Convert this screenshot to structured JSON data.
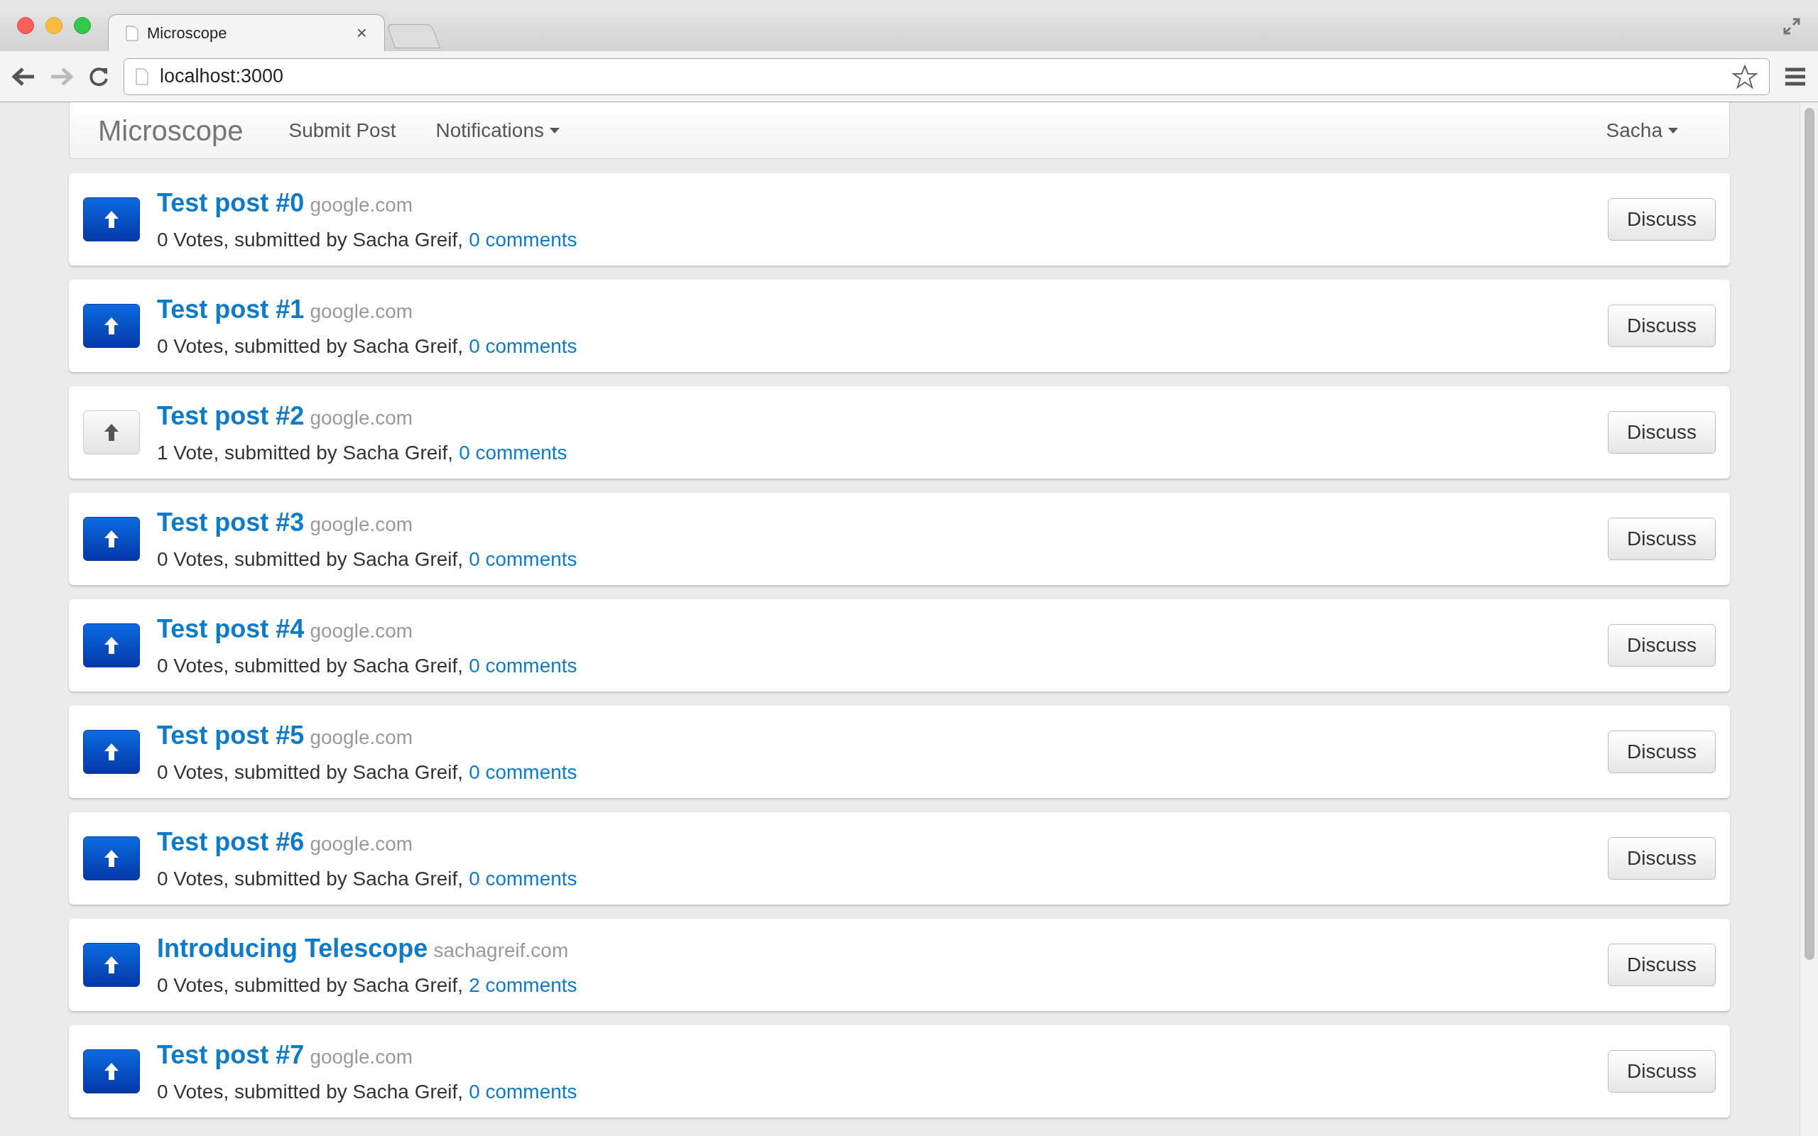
{
  "browser": {
    "tab_title": "Microscope",
    "tab_close": "×",
    "address": "localhost:3000"
  },
  "navbar": {
    "brand": "Microscope",
    "links": [
      {
        "label": "Submit Post",
        "kind": "link"
      },
      {
        "label": "Notifications",
        "kind": "dropdown"
      }
    ],
    "user": "Sacha"
  },
  "posts": [
    {
      "title": "Test post #0",
      "domain": "google.com",
      "meta": "0 Votes, submitted by Sacha Greif,",
      "comments": "0 comments",
      "upvoted": false,
      "action": "Discuss"
    },
    {
      "title": "Test post #1",
      "domain": "google.com",
      "meta": "0 Votes, submitted by Sacha Greif,",
      "comments": "0 comments",
      "upvoted": false,
      "action": "Discuss"
    },
    {
      "title": "Test post #2",
      "domain": "google.com",
      "meta": "1 Vote, submitted by Sacha Greif,",
      "comments": "0 comments",
      "upvoted": true,
      "action": "Discuss"
    },
    {
      "title": "Test post #3",
      "domain": "google.com",
      "meta": "0 Votes, submitted by Sacha Greif,",
      "comments": "0 comments",
      "upvoted": false,
      "action": "Discuss"
    },
    {
      "title": "Test post #4",
      "domain": "google.com",
      "meta": "0 Votes, submitted by Sacha Greif,",
      "comments": "0 comments",
      "upvoted": false,
      "action": "Discuss"
    },
    {
      "title": "Test post #5",
      "domain": "google.com",
      "meta": "0 Votes, submitted by Sacha Greif,",
      "comments": "0 comments",
      "upvoted": false,
      "action": "Discuss"
    },
    {
      "title": "Test post #6",
      "domain": "google.com",
      "meta": "0 Votes, submitted by Sacha Greif,",
      "comments": "0 comments",
      "upvoted": false,
      "action": "Discuss"
    },
    {
      "title": "Introducing Telescope",
      "domain": "sachagreif.com",
      "meta": "0 Votes, submitted by Sacha Greif,",
      "comments": "2 comments",
      "upvoted": false,
      "action": "Discuss"
    },
    {
      "title": "Test post #7",
      "domain": "google.com",
      "meta": "0 Votes, submitted by Sacha Greif,",
      "comments": "0 comments",
      "upvoted": false,
      "action": "Discuss"
    }
  ]
}
